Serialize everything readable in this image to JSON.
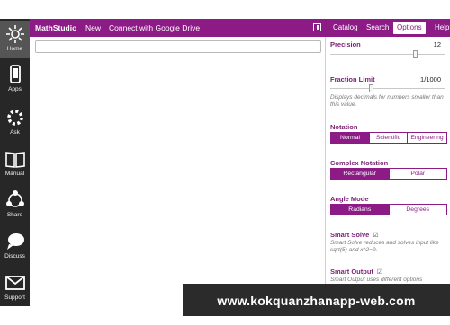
{
  "sidebar": {
    "items": [
      {
        "label": "Home",
        "icon": "home-icon"
      },
      {
        "label": "Apps",
        "icon": "phone-icon"
      },
      {
        "label": "Ask",
        "icon": "ask-gear-icon"
      },
      {
        "label": "Manual",
        "icon": "book-icon"
      },
      {
        "label": "Share",
        "icon": "share-icon"
      },
      {
        "label": "Discuss",
        "icon": "discuss-icon"
      },
      {
        "label": "Support",
        "icon": "mail-icon"
      }
    ]
  },
  "topbar": {
    "brand": "MathStudio",
    "links": [
      "New",
      "Connect with Google Drive"
    ],
    "tabs": [
      "Catalog",
      "Search",
      "Options",
      "Help"
    ],
    "selected_tab": "Options"
  },
  "options": {
    "precision": {
      "title": "Precision",
      "value": "12",
      "level": 0.75
    },
    "fraction_limit": {
      "title": "Fraction Limit",
      "value": "1/1000",
      "level": 0.35,
      "desc": "Displays decimals for numbers smaller than this value."
    },
    "notation": {
      "title": "Notation",
      "choices": [
        "Normal",
        "Scientific",
        "Engineering"
      ],
      "selected": "Normal"
    },
    "complex_notation": {
      "title": "Complex Notation",
      "choices": [
        "Rectangular",
        "Polar"
      ],
      "selected": "Rectangular"
    },
    "angle_mode": {
      "title": "Angle Mode",
      "choices": [
        "Radians",
        "Degrees"
      ],
      "selected": "Radians"
    },
    "smart_solve": {
      "title": "Smart Solve",
      "checked": true,
      "desc": "Smart Solve reduces and solves input like sqrt(5) and x^2=9."
    },
    "smart_output": {
      "title": "Smart Output",
      "checked": true,
      "desc": "Smart Output uses different options depending on the result."
    }
  },
  "watermark": {
    "text": "www.kokquanzhanapp-web.com"
  },
  "colors": {
    "accent": "#8c1b86",
    "sidebar": "#272727"
  }
}
